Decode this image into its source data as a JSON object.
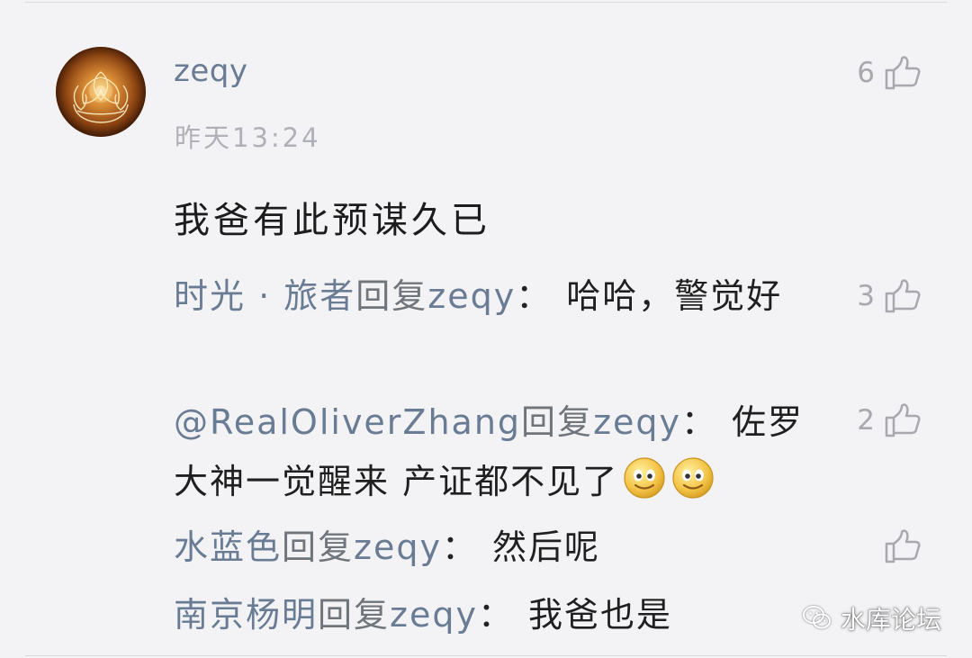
{
  "comment": {
    "author": "zeqy",
    "time": "昨天13:24",
    "text": "我爸有此预谋久已",
    "likes": "6"
  },
  "replies": [
    {
      "from": "时光 · 旅者",
      "verb": "回复",
      "to": "zeqy",
      "colon": "：",
      "text": "哈哈，警觉好",
      "likes": "3"
    },
    {
      "from": "@RealOliverZhang",
      "verb": "回复",
      "to": "zeqy",
      "colon": "：",
      "text": "佐罗大神一觉醒来 产证都不见了",
      "likes": "2",
      "emojis": [
        "smiley-icon",
        "smiley-icon"
      ]
    },
    {
      "from": "水蓝色",
      "verb": "回复",
      "to": "zeqy",
      "colon": "：",
      "text": "然后呢",
      "likes": ""
    },
    {
      "from": "南京杨明",
      "verb": "回复",
      "to": "zeqy",
      "colon": "：",
      "text": "我爸也是"
    }
  ],
  "watermark": {
    "label": "水库论坛",
    "icon": "wechat-icon"
  },
  "colors": {
    "background": "#f3f3f5",
    "name": "#697c94",
    "muted": "#a8a8ae",
    "text": "#1f1f1f"
  }
}
